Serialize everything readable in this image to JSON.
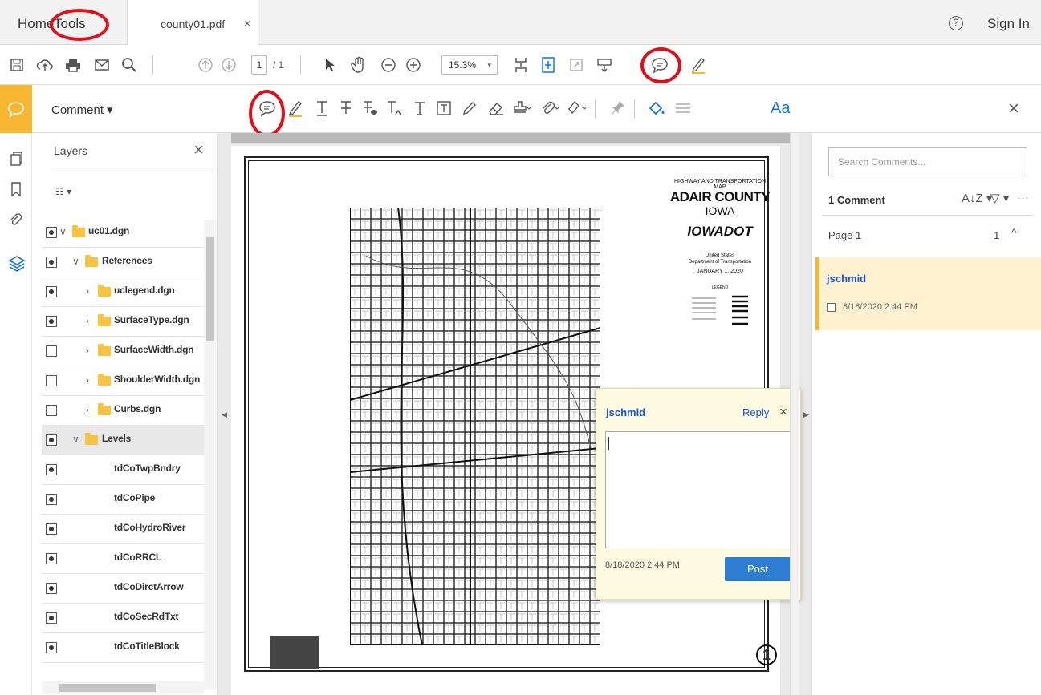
{
  "tabs": {
    "home": "Home",
    "tools": "Tools",
    "document": "county01.pdf",
    "close": "×"
  },
  "header": {
    "help": "?",
    "sign_in": "Sign In"
  },
  "toolbar": {
    "page_current": "1",
    "page_total": "/ 1",
    "zoom": "15.3%",
    "zoom_caret": "▾"
  },
  "comment_bar": {
    "title": "Comment ▾",
    "text_style": "Aa",
    "close": "×"
  },
  "layers": {
    "title": "Layers",
    "close": "×",
    "options": "☷ ▾",
    "items": [
      {
        "label": "uc01.dgn",
        "visible": true,
        "expanded": true
      },
      {
        "label": "References",
        "visible": true,
        "expanded": true
      },
      {
        "label": "uclegend.dgn",
        "visible": true,
        "expanded": false
      },
      {
        "label": "SurfaceType.dgn",
        "visible": true,
        "expanded": false
      },
      {
        "label": "SurfaceWidth.dgn",
        "visible": false,
        "expanded": false
      },
      {
        "label": "ShoulderWidth.dgn",
        "visible": false,
        "expanded": false
      },
      {
        "label": "Curbs.dgn",
        "visible": false,
        "expanded": false
      },
      {
        "label": "Levels",
        "visible": true,
        "expanded": true,
        "selected": true
      },
      {
        "label": "tdCoTwpBndry",
        "visible": true
      },
      {
        "label": "tdCoPipe",
        "visible": true
      },
      {
        "label": "tdCoHydroRiver",
        "visible": true
      },
      {
        "label": "tdCoRRCL",
        "visible": true
      },
      {
        "label": "tdCoDirctArrow",
        "visible": true
      },
      {
        "label": "tdCoSecRdTxt",
        "visible": true
      },
      {
        "label": "tdCoTitleBlock",
        "visible": true
      }
    ]
  },
  "map": {
    "heading": "HIGHWAY AND TRANSPORTATION MAP",
    "county": "ADAIR COUNTY",
    "state": "IOWA",
    "agency": "IOWADOT",
    "partner_line1": "United States",
    "partner_line2": "Department of Transportation",
    "date": "JANUARY 1, 2020",
    "legend": "LEGEND",
    "sheet": "1"
  },
  "popup": {
    "user": "jschmid",
    "reply": "Reply",
    "close": "×",
    "text": "",
    "date": "8/18/2020  2:44 PM",
    "post": "Post"
  },
  "comments_panel": {
    "search_placeholder": "Search Comments...",
    "count": "1 Comment",
    "sort": "A↓Z ▾",
    "filter": "▽ ▾",
    "more": "···",
    "page_label": "Page 1",
    "page_count": "1",
    "page_caret": "^",
    "comment": {
      "user": "jschmid",
      "date": "8/18/2020  2:44 PM"
    }
  },
  "colors": {
    "accent": "#f7b731",
    "link": "#1a55d6",
    "button": "#2d7dd2",
    "highlight_ring": "#e0101a"
  }
}
